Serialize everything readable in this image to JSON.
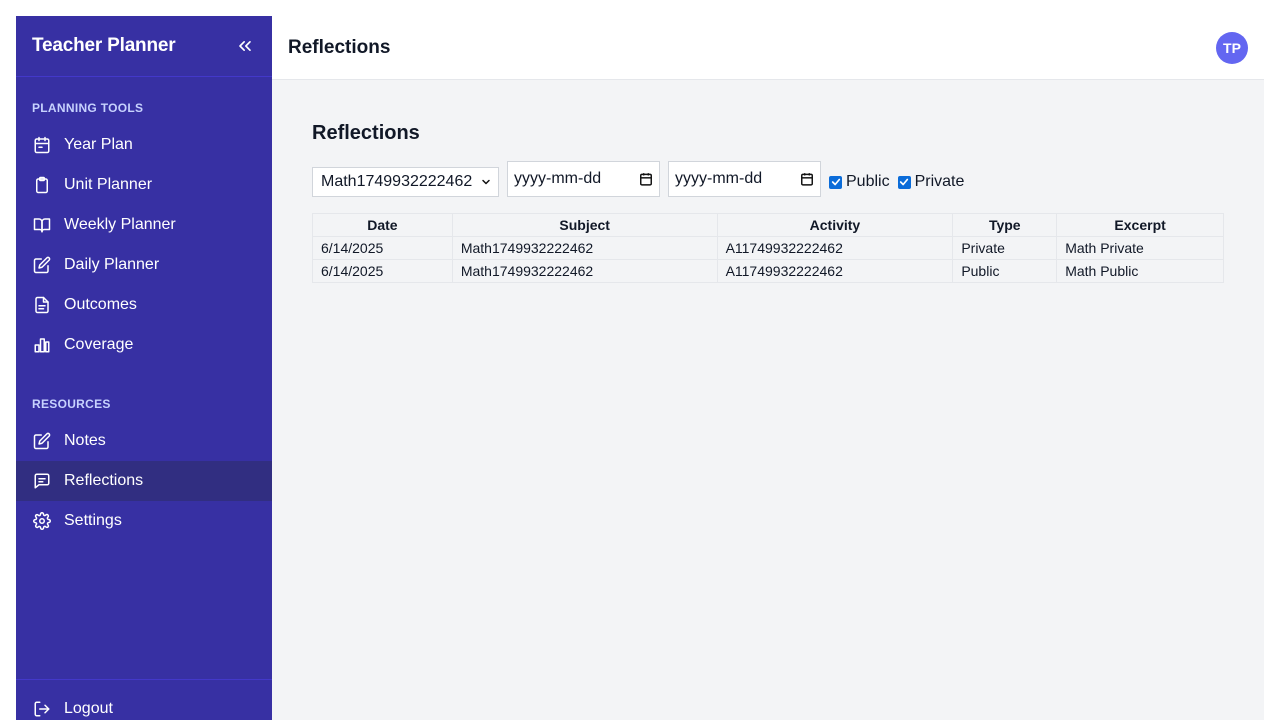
{
  "sidebar": {
    "title": "Teacher Planner",
    "sections": [
      {
        "label": "PLANNING TOOLS"
      },
      {
        "label": "RESOURCES"
      }
    ],
    "planning_items": [
      {
        "label": "Year Plan",
        "icon": "calendar-icon"
      },
      {
        "label": "Unit Planner",
        "icon": "clipboard-icon"
      },
      {
        "label": "Weekly Planner",
        "icon": "book-open-icon"
      },
      {
        "label": "Daily Planner",
        "icon": "edit-icon"
      },
      {
        "label": "Outcomes",
        "icon": "document-icon"
      },
      {
        "label": "Coverage",
        "icon": "chart-icon"
      }
    ],
    "resource_items": [
      {
        "label": "Notes",
        "icon": "edit-icon"
      },
      {
        "label": "Reflections",
        "icon": "chat-icon",
        "active": true
      },
      {
        "label": "Settings",
        "icon": "gear-icon"
      }
    ],
    "logout_label": "Logout"
  },
  "topbar": {
    "title": "Reflections",
    "avatar_initials": "TP"
  },
  "main": {
    "heading": "Reflections",
    "filters": {
      "subject_selected": "Math1749932222462",
      "date_from_placeholder": "yyyy-mm-dd",
      "date_to_placeholder": "yyyy-mm-dd",
      "public_label": "Public",
      "private_label": "Private",
      "public_checked": true,
      "private_checked": true
    },
    "table": {
      "headers": [
        "Date",
        "Subject",
        "Activity",
        "Type",
        "Excerpt"
      ],
      "rows": [
        [
          "6/14/2025",
          "Math1749932222462",
          "A11749932222462",
          "Private",
          "Math Private"
        ],
        [
          "6/14/2025",
          "Math1749932222462",
          "A11749932222462",
          "Public",
          "Math Public"
        ]
      ]
    }
  },
  "colors": {
    "sidebar_bg": "#3730a3",
    "sidebar_active": "#312e81",
    "avatar_bg": "#6366f1",
    "checkbox": "#0b6cd9"
  }
}
